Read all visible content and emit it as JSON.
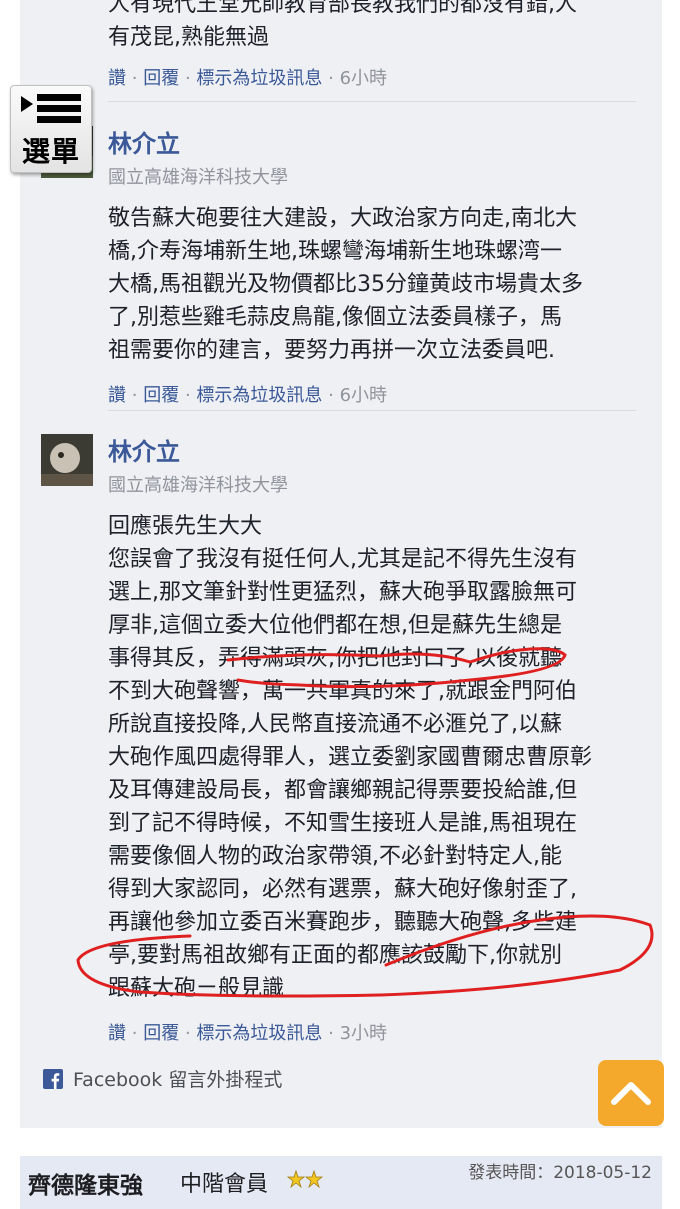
{
  "comments": [
    {
      "text_lines": [
        "人有現代王堂允師教育部長教我們的都沒有錯,人",
        "有茂昆,熟能無過"
      ],
      "actions": {
        "read": "讚",
        "reply": "回覆",
        "spam": "標示為垃圾訊息",
        "sep": "·",
        "time": "6小時"
      }
    },
    {
      "author": "林介立",
      "school": "國立高雄海洋科技大學",
      "text_lines": [
        "敬告蘇大砲要往大建設，大政治家方向走,南北大",
        "橋,介寿海埔新生地,珠螺彎海埔新生地珠螺湾一",
        "大橋,馬祖觀光及物價都比35分鐘黄歧市場貴太多",
        "了,別惹些雞毛蒜皮鳥龍,像個立法委員樣子，馬",
        "祖需要你的建言，要努力再拼一次立法委員吧."
      ],
      "actions": {
        "read": "讚",
        "reply": "回覆",
        "spam": "標示為垃圾訊息",
        "sep": "·",
        "time": "6小時"
      }
    },
    {
      "author": "林介立",
      "school": "國立高雄海洋科技大學",
      "text_lines": [
        "回應張先生大大",
        "您誤會了我沒有挺任何人,尤其是記不得先生沒有",
        "選上,那文筆針對性更猛烈，蘇大砲爭取露臉無可",
        "厚非,這個立委大位他們都在想,但是蘇先生總是",
        "事得其反，弄得滿頭灰,你把他封口了,以後就聽",
        "不到大砲聲響，萬一共軍真的來了,就跟金門阿伯",
        "所說直接投降,人民幣直接流通不必滙兑了,以蘇",
        "大砲作風四處得罪人，選立委劉家國曹爾忠曹原彰",
        "及耳傳建設局長，都會讓鄉親記得票要投給誰,但",
        "到了記不得時候，不知雪生接班人是誰,馬祖現在",
        "需要像個人物的政治家帶領,不必針對特定人,能",
        "得到大家認同，必然有選票，蘇大砲好像射歪了,",
        "再讓他參加立委百米賽跑步，聽聽大砲聲,多些建",
        "亭,要對馬祖故鄉有正面的都應該鼓勵下,你就別",
        "跟蘇大砲ㄧ般見識"
      ],
      "actions": {
        "read": "讚",
        "reply": "回覆",
        "spam": "標示為垃圾訊息",
        "sep": "·",
        "time": "3小時"
      }
    }
  ],
  "menu": {
    "label": "選單",
    "icon": "menu-list-icon"
  },
  "plugin": {
    "label": "Facebook 留言外掛程式",
    "icon": "facebook-icon"
  },
  "back_to_top": {
    "icon": "chevron-up-icon"
  },
  "footer": {
    "user": "齊德隆東強",
    "rank": "中階會員",
    "stars_icon": "two-stars-icon",
    "posted": "發表時間：2018-05-12"
  },
  "colors": {
    "link": "#3b5998",
    "panel": "#eef0f3",
    "annotation": "#e02020",
    "to_top": "#f5a623"
  }
}
